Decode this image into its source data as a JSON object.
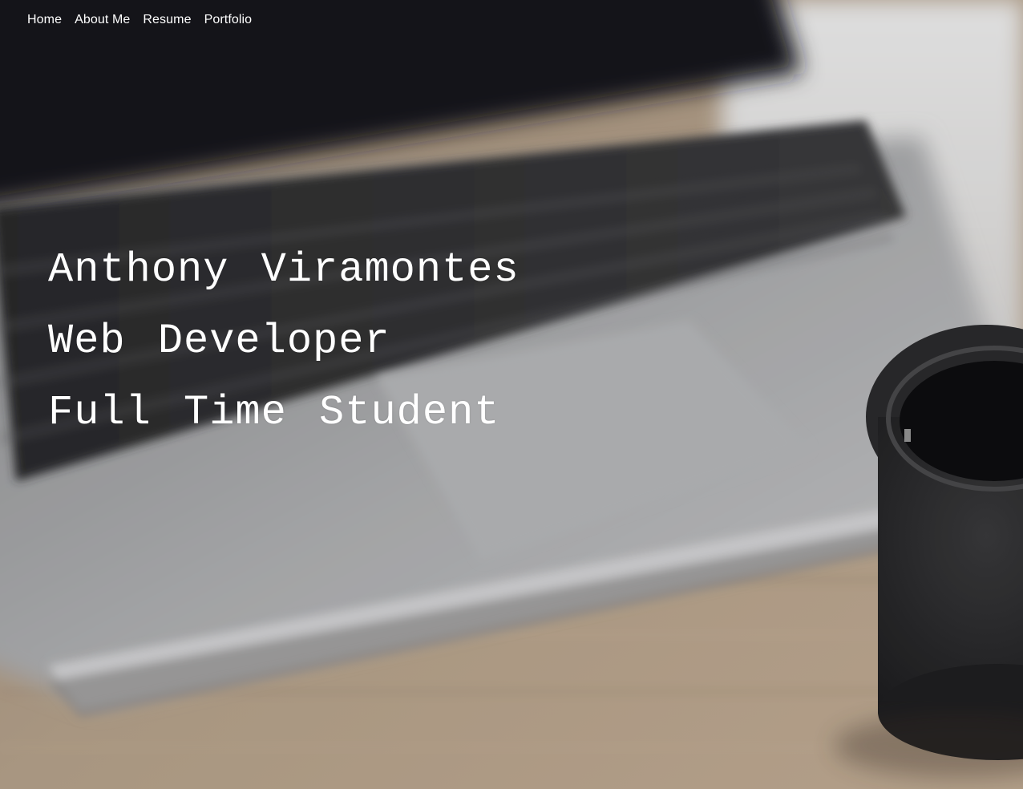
{
  "nav": {
    "items": [
      {
        "label": "Home"
      },
      {
        "label": "About Me"
      },
      {
        "label": "Resume"
      },
      {
        "label": "Portfolio"
      }
    ]
  },
  "hero": {
    "lines": [
      "Anthony Viramontes",
      "Web Developer",
      "Full Time Student"
    ],
    "background_description_colors": {
      "laptop_dark": "#1b1b1d",
      "laptop_silver": "#a9aaac",
      "desk_wood": "#b39f89",
      "mug": "#2c2c2e",
      "text": "#ffffff"
    }
  }
}
